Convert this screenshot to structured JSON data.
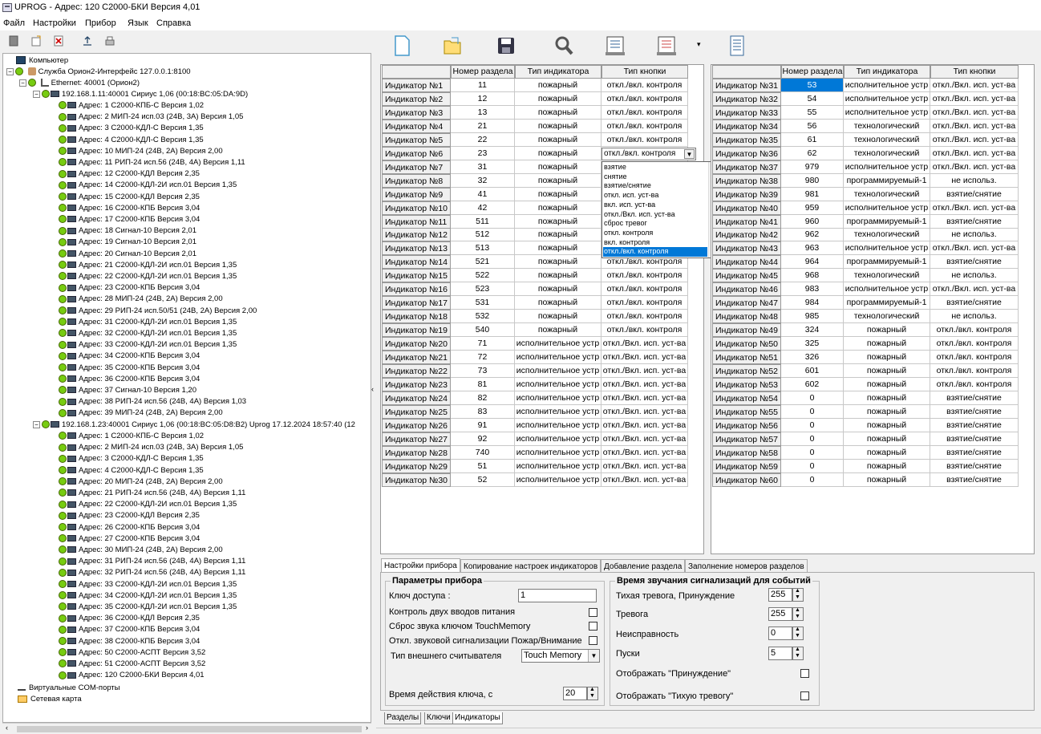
{
  "window": {
    "title": "UPROG - Адрес: 120 С2000-БКИ Версия 4,01"
  },
  "menu": [
    "Файл",
    "Настройки",
    "Прибор",
    "Язык",
    "Справка"
  ],
  "tree": {
    "root": "Компьютер",
    "service": "Служба Орион2-Интерфейс 127.0.0.1:8100",
    "ethernet": "Ethernet: 40001  (Орион2)",
    "sirius1": "192.168.1.11:40001 Сириус 1,06 (00:18:BC:05:DA:9D)",
    "sirius1_devices": [
      "Адрес: 1 С2000-КПБ-С Версия 1,02",
      "Адрес: 2 МИП-24 исп.03 (24В, 3А) Версия 1,05",
      "Адрес: 3 С2000-КДЛ-С Версия 1,35",
      "Адрес: 4 С2000-КДЛ-С Версия 1,35",
      "Адрес: 10 МИП-24 (24В, 2А) Версия 2,00",
      "Адрес: 11 РИП-24 исп.56 (24В, 4А) Версия 1,11",
      "Адрес: 12 С2000-КДЛ Версия 2,35",
      "Адрес: 14 С2000-КДЛ-2И исп.01 Версия 1,35",
      "Адрес: 15 С2000-КДЛ Версия 2,35",
      "Адрес: 16 С2000-КПБ Версия 3,04",
      "Адрес: 17 С2000-КПБ Версия 3,04",
      "Адрес: 18 Сигнал-10 Версия 2,01",
      "Адрес: 19 Сигнал-10 Версия 2,01",
      "Адрес: 20 Сигнал-10 Версия 2,01",
      "Адрес: 21 С2000-КДЛ-2И исп.01 Версия 1,35",
      "Адрес: 22 С2000-КДЛ-2И исп.01 Версия 1,35",
      "Адрес: 23 С2000-КПБ Версия 3,04",
      "Адрес: 28 МИП-24 (24В, 2А) Версия 2,00",
      "Адрес: 29 РИП-24 исп.50/51 (24В, 2А) Версия 2,00",
      "Адрес: 31 С2000-КДЛ-2И исп.01 Версия 1,35",
      "Адрес: 32 С2000-КДЛ-2И исп.01 Версия 1,35",
      "Адрес: 33 С2000-КДЛ-2И исп.01 Версия 1,35",
      "Адрес: 34 С2000-КПБ Версия 3,04",
      "Адрес: 35 С2000-КПБ Версия 3,04",
      "Адрес: 36 С2000-КПБ Версия 3,04",
      "Адрес: 37 Сигнал-10 Версия 1,20",
      "Адрес: 38 РИП-24 исп.56 (24В, 4А) Версия 1,03",
      "Адрес: 39 МИП-24 (24В, 2А) Версия 2,00"
    ],
    "sirius2": "192.168.1.23:40001 Сириус 1,06 (00:18:BC:05:D8:B2)  Uprog 17.12.2024 18:57:40 (12",
    "sirius2_devices": [
      "Адрес: 1 С2000-КПБ-С Версия 1,02",
      "Адрес: 2 МИП-24 исп.03 (24В, 3А) Версия 1,05",
      "Адрес: 3 С2000-КДЛ-С Версия 1,35",
      "Адрес: 4 С2000-КДЛ-С Версия 1,35",
      "Адрес: 20 МИП-24 (24В, 2А) Версия 2,00",
      "Адрес: 21 РИП-24 исп.56 (24В, 4А) Версия 1,11",
      "Адрес: 22 С2000-КДЛ-2И исп.01 Версия 1,35",
      "Адрес: 23 С2000-КДЛ Версия 2,35",
      "Адрес: 26 С2000-КПБ Версия 3,04",
      "Адрес: 27 С2000-КПБ Версия 3,04",
      "Адрес: 30 МИП-24 (24В, 2А) Версия 2,00",
      "Адрес: 31 РИП-24 исп.56 (24В, 4А) Версия 1,11",
      "Адрес: 32 РИП-24 исп.56 (24В, 4А) Версия 1,11",
      "Адрес: 33 С2000-КДЛ-2И исп.01 Версия 1,35",
      "Адрес: 34 С2000-КДЛ-2И исп.01 Версия 1,35",
      "Адрес: 35 С2000-КДЛ-2И исп.01 Версия 1,35",
      "Адрес: 36 С2000-КДЛ Версия 2,35",
      "Адрес: 37 С2000-КПБ Версия 3,04",
      "Адрес: 38 С2000-КПБ Версия 3,04",
      "Адрес: 50 С2000-АСПТ Версия 3,52",
      "Адрес: 51 С2000-АСПТ Версия 3,52",
      "Адрес: 120 С2000-БКИ Версия 4,01"
    ],
    "virtual_com": "Виртуальные COM-порты",
    "network_card": "Сетевая карта"
  },
  "grid_headers": {
    "section": "Номер раздела",
    "ind_type": "Тип индикатора",
    "btn_type": "Тип кнопки"
  },
  "grid_left": [
    [
      "Индикатор №1",
      "11",
      "пожарный",
      "откл./вкл. контроля"
    ],
    [
      "Индикатор №2",
      "12",
      "пожарный",
      "откл./вкл. контроля"
    ],
    [
      "Индикатор №3",
      "13",
      "пожарный",
      "откл./вкл. контроля"
    ],
    [
      "Индикатор №4",
      "21",
      "пожарный",
      "откл./вкл. контроля"
    ],
    [
      "Индикатор №5",
      "22",
      "пожарный",
      "откл./вкл. контроля"
    ],
    [
      "Индикатор №6",
      "23",
      "пожарный",
      ""
    ],
    [
      "Индикатор №7",
      "31",
      "пожарный",
      ""
    ],
    [
      "Индикатор №8",
      "32",
      "пожарный",
      ""
    ],
    [
      "Индикатор №9",
      "41",
      "пожарный",
      ""
    ],
    [
      "Индикатор №10",
      "42",
      "пожарный",
      ""
    ],
    [
      "Индикатор №11",
      "511",
      "пожарный",
      ""
    ],
    [
      "Индикатор №12",
      "512",
      "пожарный",
      ""
    ],
    [
      "Индикатор №13",
      "513",
      "пожарный",
      ""
    ],
    [
      "Индикатор №14",
      "521",
      "пожарный",
      "откл./вкл. контроля"
    ],
    [
      "Индикатор №15",
      "522",
      "пожарный",
      "откл./вкл. контроля"
    ],
    [
      "Индикатор №16",
      "523",
      "пожарный",
      "откл./вкл. контроля"
    ],
    [
      "Индикатор №17",
      "531",
      "пожарный",
      "откл./вкл. контроля"
    ],
    [
      "Индикатор №18",
      "532",
      "пожарный",
      "откл./вкл. контроля"
    ],
    [
      "Индикатор №19",
      "540",
      "пожарный",
      "откл./вкл. контроля"
    ],
    [
      "Индикатор №20",
      "71",
      "исполнительное устр",
      "откл./Вкл. исп. уст-ва"
    ],
    [
      "Индикатор №21",
      "72",
      "исполнительное устр",
      "откл./Вкл. исп. уст-ва"
    ],
    [
      "Индикатор №22",
      "73",
      "исполнительное устр",
      "откл./Вкл. исп. уст-ва"
    ],
    [
      "Индикатор №23",
      "81",
      "исполнительное устр",
      "откл./Вкл. исп. уст-ва"
    ],
    [
      "Индикатор №24",
      "82",
      "исполнительное устр",
      "откл./Вкл. исп. уст-ва"
    ],
    [
      "Индикатор №25",
      "83",
      "исполнительное устр",
      "откл./Вкл. исп. уст-ва"
    ],
    [
      "Индикатор №26",
      "91",
      "исполнительное устр",
      "откл./Вкл. исп. уст-ва"
    ],
    [
      "Индикатор №27",
      "92",
      "исполнительное устр",
      "откл./Вкл. исп. уст-ва"
    ],
    [
      "Индикатор №28",
      "740",
      "исполнительное устр",
      "откл./Вкл. исп. уст-ва"
    ],
    [
      "Индикатор №29",
      "51",
      "исполнительное устр",
      "откл./Вкл. исп. уст-ва"
    ],
    [
      "Индикатор №30",
      "52",
      "исполнительное устр",
      "откл./Вкл. исп. уст-ва"
    ]
  ],
  "grid_right": [
    [
      "Индикатор №31",
      "53",
      "исполнительное устр",
      "откл./Вкл. исп. уст-ва"
    ],
    [
      "Индикатор №32",
      "54",
      "исполнительное устр",
      "откл./Вкл. исп. уст-ва"
    ],
    [
      "Индикатор №33",
      "55",
      "исполнительное устр",
      "откл./Вкл. исп. уст-ва"
    ],
    [
      "Индикатор №34",
      "56",
      "технологический",
      "откл./Вкл. исп. уст-ва"
    ],
    [
      "Индикатор №35",
      "61",
      "технологический",
      "откл./Вкл. исп. уст-ва"
    ],
    [
      "Индикатор №36",
      "62",
      "технологический",
      "откл./Вкл. исп. уст-ва"
    ],
    [
      "Индикатор №37",
      "979",
      "исполнительное устр",
      "откл./Вкл. исп. уст-ва"
    ],
    [
      "Индикатор №38",
      "980",
      "программируемый-1",
      "не использ."
    ],
    [
      "Индикатор №39",
      "981",
      "технологический",
      "взятие/снятие"
    ],
    [
      "Индикатор №40",
      "959",
      "исполнительное устр",
      "откл./Вкл. исп. уст-ва"
    ],
    [
      "Индикатор №41",
      "960",
      "программируемый-1",
      "взятие/снятие"
    ],
    [
      "Индикатор №42",
      "962",
      "технологический",
      "не использ."
    ],
    [
      "Индикатор №43",
      "963",
      "исполнительное устр",
      "откл./Вкл. исп. уст-ва"
    ],
    [
      "Индикатор №44",
      "964",
      "программируемый-1",
      "взятие/снятие"
    ],
    [
      "Индикатор №45",
      "968",
      "технологический",
      "не использ."
    ],
    [
      "Индикатор №46",
      "983",
      "исполнительное устр",
      "откл./Вкл. исп. уст-ва"
    ],
    [
      "Индикатор №47",
      "984",
      "программируемый-1",
      "взятие/снятие"
    ],
    [
      "Индикатор №48",
      "985",
      "технологический",
      "не использ."
    ],
    [
      "Индикатор №49",
      "324",
      "пожарный",
      "откл./вкл. контроля"
    ],
    [
      "Индикатор №50",
      "325",
      "пожарный",
      "откл./вкл. контроля"
    ],
    [
      "Индикатор №51",
      "326",
      "пожарный",
      "откл./вкл. контроля"
    ],
    [
      "Индикатор №52",
      "601",
      "пожарный",
      "откл./вкл. контроля"
    ],
    [
      "Индикатор №53",
      "602",
      "пожарный",
      "откл./вкл. контроля"
    ],
    [
      "Индикатор №54",
      "0",
      "пожарный",
      "взятие/снятие"
    ],
    [
      "Индикатор №55",
      "0",
      "пожарный",
      "взятие/снятие"
    ],
    [
      "Индикатор №56",
      "0",
      "пожарный",
      "взятие/снятие"
    ],
    [
      "Индикатор №57",
      "0",
      "пожарный",
      "взятие/снятие"
    ],
    [
      "Индикатор №58",
      "0",
      "пожарный",
      "взятие/снятие"
    ],
    [
      "Индикатор №59",
      "0",
      "пожарный",
      "взятие/снятие"
    ],
    [
      "Индикатор №60",
      "0",
      "пожарный",
      "взятие/снятие"
    ]
  ],
  "dropdown": {
    "current": "откл./вкл. контроля",
    "options": [
      "взятие",
      "снятие",
      "взятие/снятие",
      "откл. исп. уст-ва",
      "вкл. исп. уст-ва",
      "откл./Вкл. исп. уст-ва",
      "сброс тревог",
      "откл. контроля",
      "вкл. контроля",
      "откл./вкл. контроля"
    ]
  },
  "tabs": [
    "Настройки прибора",
    "Копирование настроек индикаторов",
    "Добавление раздела",
    "Заполнение номеров разделов"
  ],
  "settings": {
    "group_params": "Параметры прибора",
    "access_key_label": "Ключ доступа :",
    "access_key_value": "1",
    "two_power_label": "Контроль двух вводов питания",
    "reset_sound_label": "Сброс звука ключом TouchMemory",
    "disable_sound_label": "Откл. звуковой сигнализации Пожар/Внимание",
    "reader_type_label": "Тип внешнего считывателя",
    "reader_type_value": "Touch Memory",
    "key_time_label": "Время действия ключа, с",
    "key_time_value": "20",
    "group_sound": "Время звучания сигнализаций для событий",
    "silent_alarm_label": "Тихая тревога, Принуждение",
    "silent_alarm_value": "255",
    "alarm_label": "Тревога",
    "alarm_value": "255",
    "fault_label": "Неисправность",
    "fault_value": "0",
    "starts_label": "Пуски",
    "starts_value": "5",
    "show_duress_label": "Отображать \"Принуждение\"",
    "show_silent_label": "Отображать \"Тихую тревогу\""
  },
  "bottom_tabs": [
    "Разделы",
    "Ключи",
    "Индикаторы"
  ]
}
